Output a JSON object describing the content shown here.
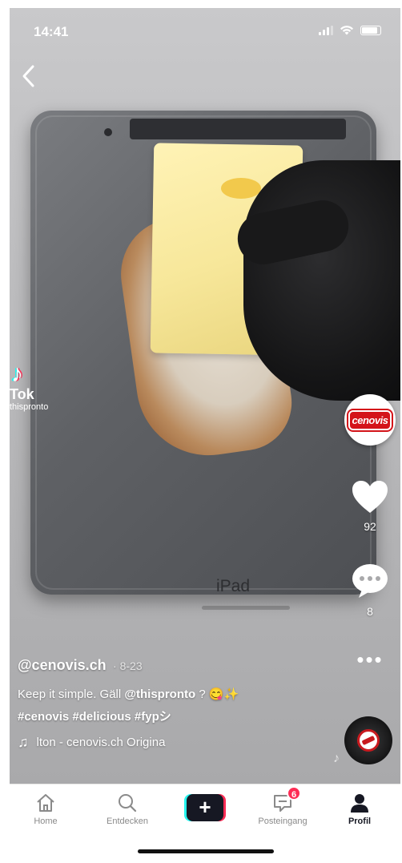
{
  "status_bar": {
    "time": "14:41"
  },
  "watermark": {
    "logo_text": "Tok",
    "user": "thispronto"
  },
  "video": {
    "device_label": "iPad"
  },
  "rail": {
    "avatar_badge": "cenovis",
    "likes": "92",
    "comments": "8"
  },
  "caption": {
    "username": "@cenovis.ch",
    "date": "· 8-23",
    "text_before": "Keep it simple. Gäll ",
    "mention": "@thispronto",
    "text_after": " ? 😋✨",
    "hashtags": "#cenovis #delicious #fypシ",
    "music": "lton - cenovis.ch    Origina"
  },
  "tabbar": {
    "home": "Home",
    "discover": "Entdecken",
    "create": "+",
    "inbox": "Posteingang",
    "inbox_badge": "6",
    "profile": "Profil"
  },
  "colors": {
    "accent": "#fe2c55",
    "cyan": "#25f4ee",
    "brand_red": "#d4141a"
  }
}
